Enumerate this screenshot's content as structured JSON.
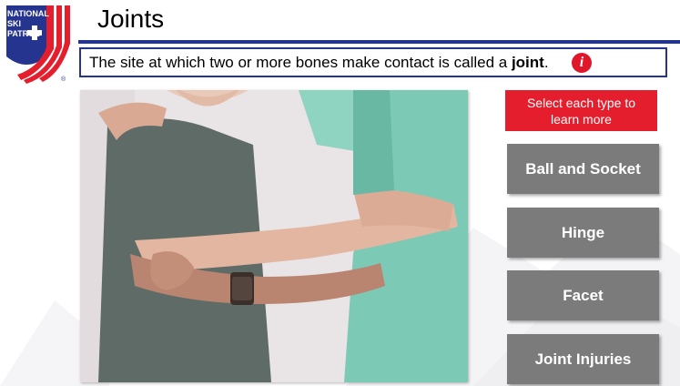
{
  "logo": {
    "text_line1": "NATIONAL",
    "text_line2": "SKI",
    "text_line3": "PATROL",
    "registered": "®"
  },
  "header": {
    "title": "Joints"
  },
  "definition": {
    "text_before": "The site at which two or more bones make contact is called a ",
    "term": "joint",
    "text_after": "."
  },
  "instruction": {
    "text": "Select each type to learn more"
  },
  "buttons": [
    {
      "label": "Ball and Socket"
    },
    {
      "label": "Hinge"
    },
    {
      "label": "Facet"
    },
    {
      "label": "Joint Injuries"
    }
  ],
  "colors": {
    "brand_blue": "#24348f",
    "brand_red": "#e41e2c",
    "button_gray": "#7b7b7b"
  },
  "icons": {
    "info": "info-icon"
  }
}
